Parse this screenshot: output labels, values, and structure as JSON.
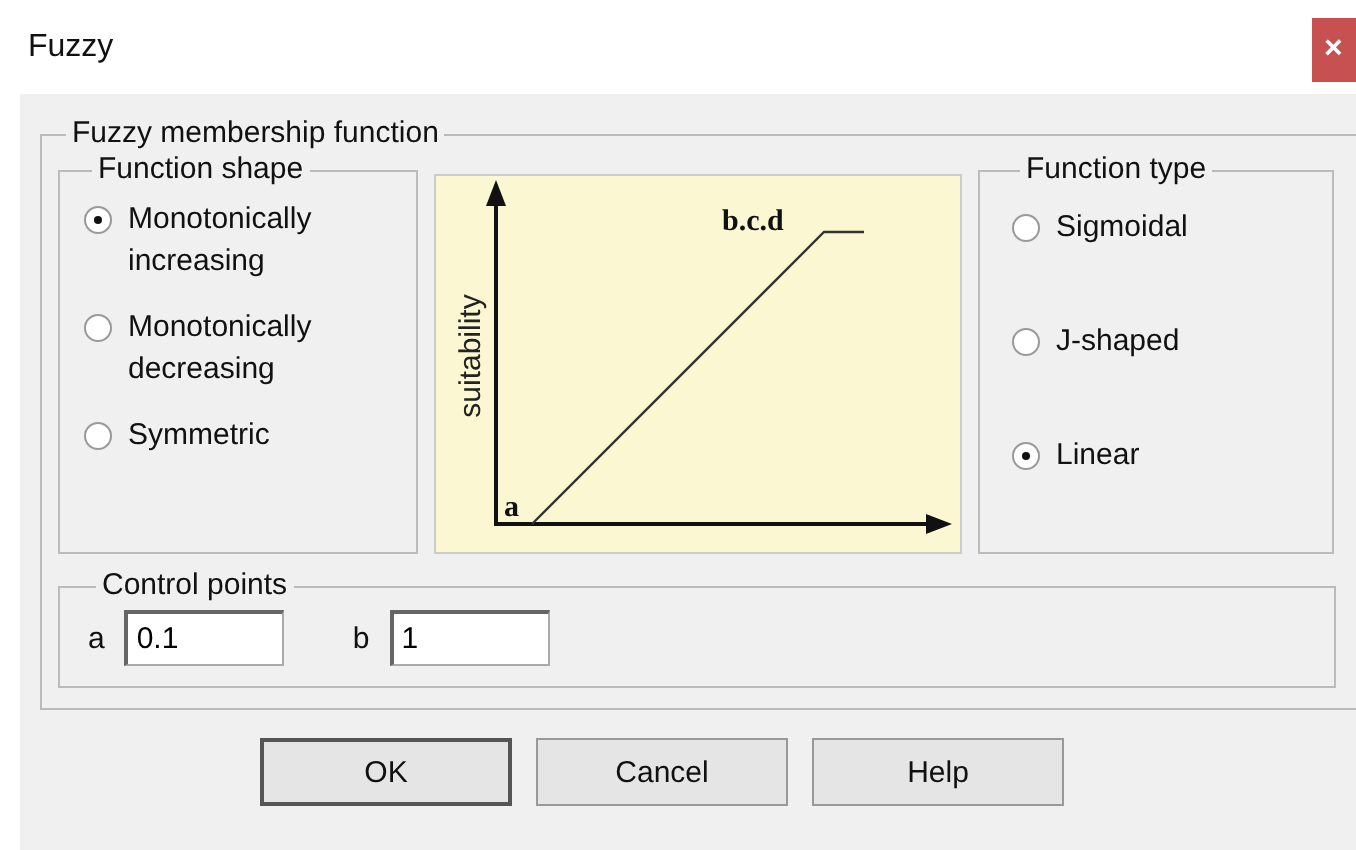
{
  "window": {
    "title": "Fuzzy",
    "close": "×"
  },
  "membership": {
    "title": "Fuzzy membership function",
    "shape": {
      "title": "Function shape",
      "options": [
        {
          "label": "Monotonically increasing",
          "selected": true
        },
        {
          "label": "Monotonically decreasing",
          "selected": false
        },
        {
          "label": "Symmetric",
          "selected": false
        }
      ]
    },
    "diagram": {
      "ylabel": "suitability",
      "start_label": "a",
      "end_label": "b.c.d"
    },
    "type": {
      "title": "Function type",
      "options": [
        {
          "label": "Sigmoidal",
          "selected": false
        },
        {
          "label": "J-shaped",
          "selected": false
        },
        {
          "label": "Linear",
          "selected": true
        }
      ]
    },
    "control_points": {
      "title": "Control points",
      "fields": [
        {
          "label": "a",
          "value": "0.1"
        },
        {
          "label": "b",
          "value": "1"
        }
      ]
    }
  },
  "buttons": [
    {
      "label": "OK",
      "default": true
    },
    {
      "label": "Cancel",
      "default": false
    },
    {
      "label": "Help",
      "default": false
    }
  ]
}
